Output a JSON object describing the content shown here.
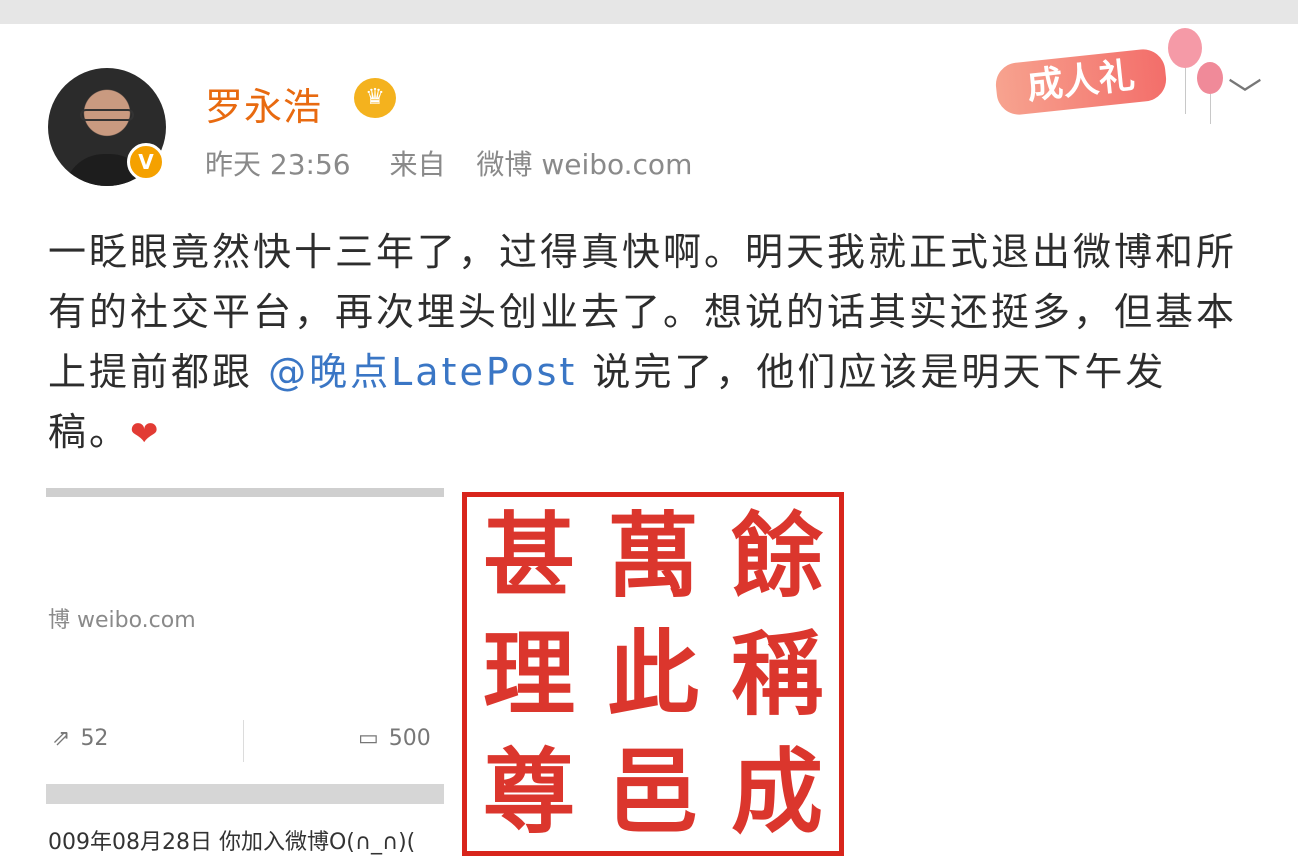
{
  "user": {
    "name": "罗永浩",
    "verified_badge": "V",
    "timestamp": "昨天 23:56",
    "source_prefix": "来自",
    "source": "微博 weibo.com"
  },
  "post": {
    "text_before_mention": "一眨眼竟然快十三年了，过得真快啊。明天我就正式退出微博和所有的社交平台，再次埋头创业去了。想说的话其实还挺多，但基本上提前都跟 ",
    "mention": "@晚点LatePost",
    "text_after_mention": " 说完了，他们应该是明天下午发稿。",
    "emoji": "❤"
  },
  "badge": {
    "text": "成人礼"
  },
  "embed": {
    "source": "博 weibo.com",
    "repost_count": "52",
    "comment_count": "500",
    "join_text": "009年08月28日 你加入微博O(∩_∩)("
  },
  "seal": {
    "characters": [
      "甚",
      "萬",
      "餘",
      "理",
      "此",
      "稱",
      "尊",
      "邑",
      "成"
    ]
  },
  "icons": {
    "crown": "crown-icon",
    "chevron": "chevron-down-icon",
    "repost": "share-icon",
    "comment": "comment-icon"
  },
  "colors": {
    "username": "#e86a10",
    "mention": "#3a76c5",
    "verified": "#f5a100",
    "seal": "#d8251c",
    "heart": "#e23b34"
  }
}
